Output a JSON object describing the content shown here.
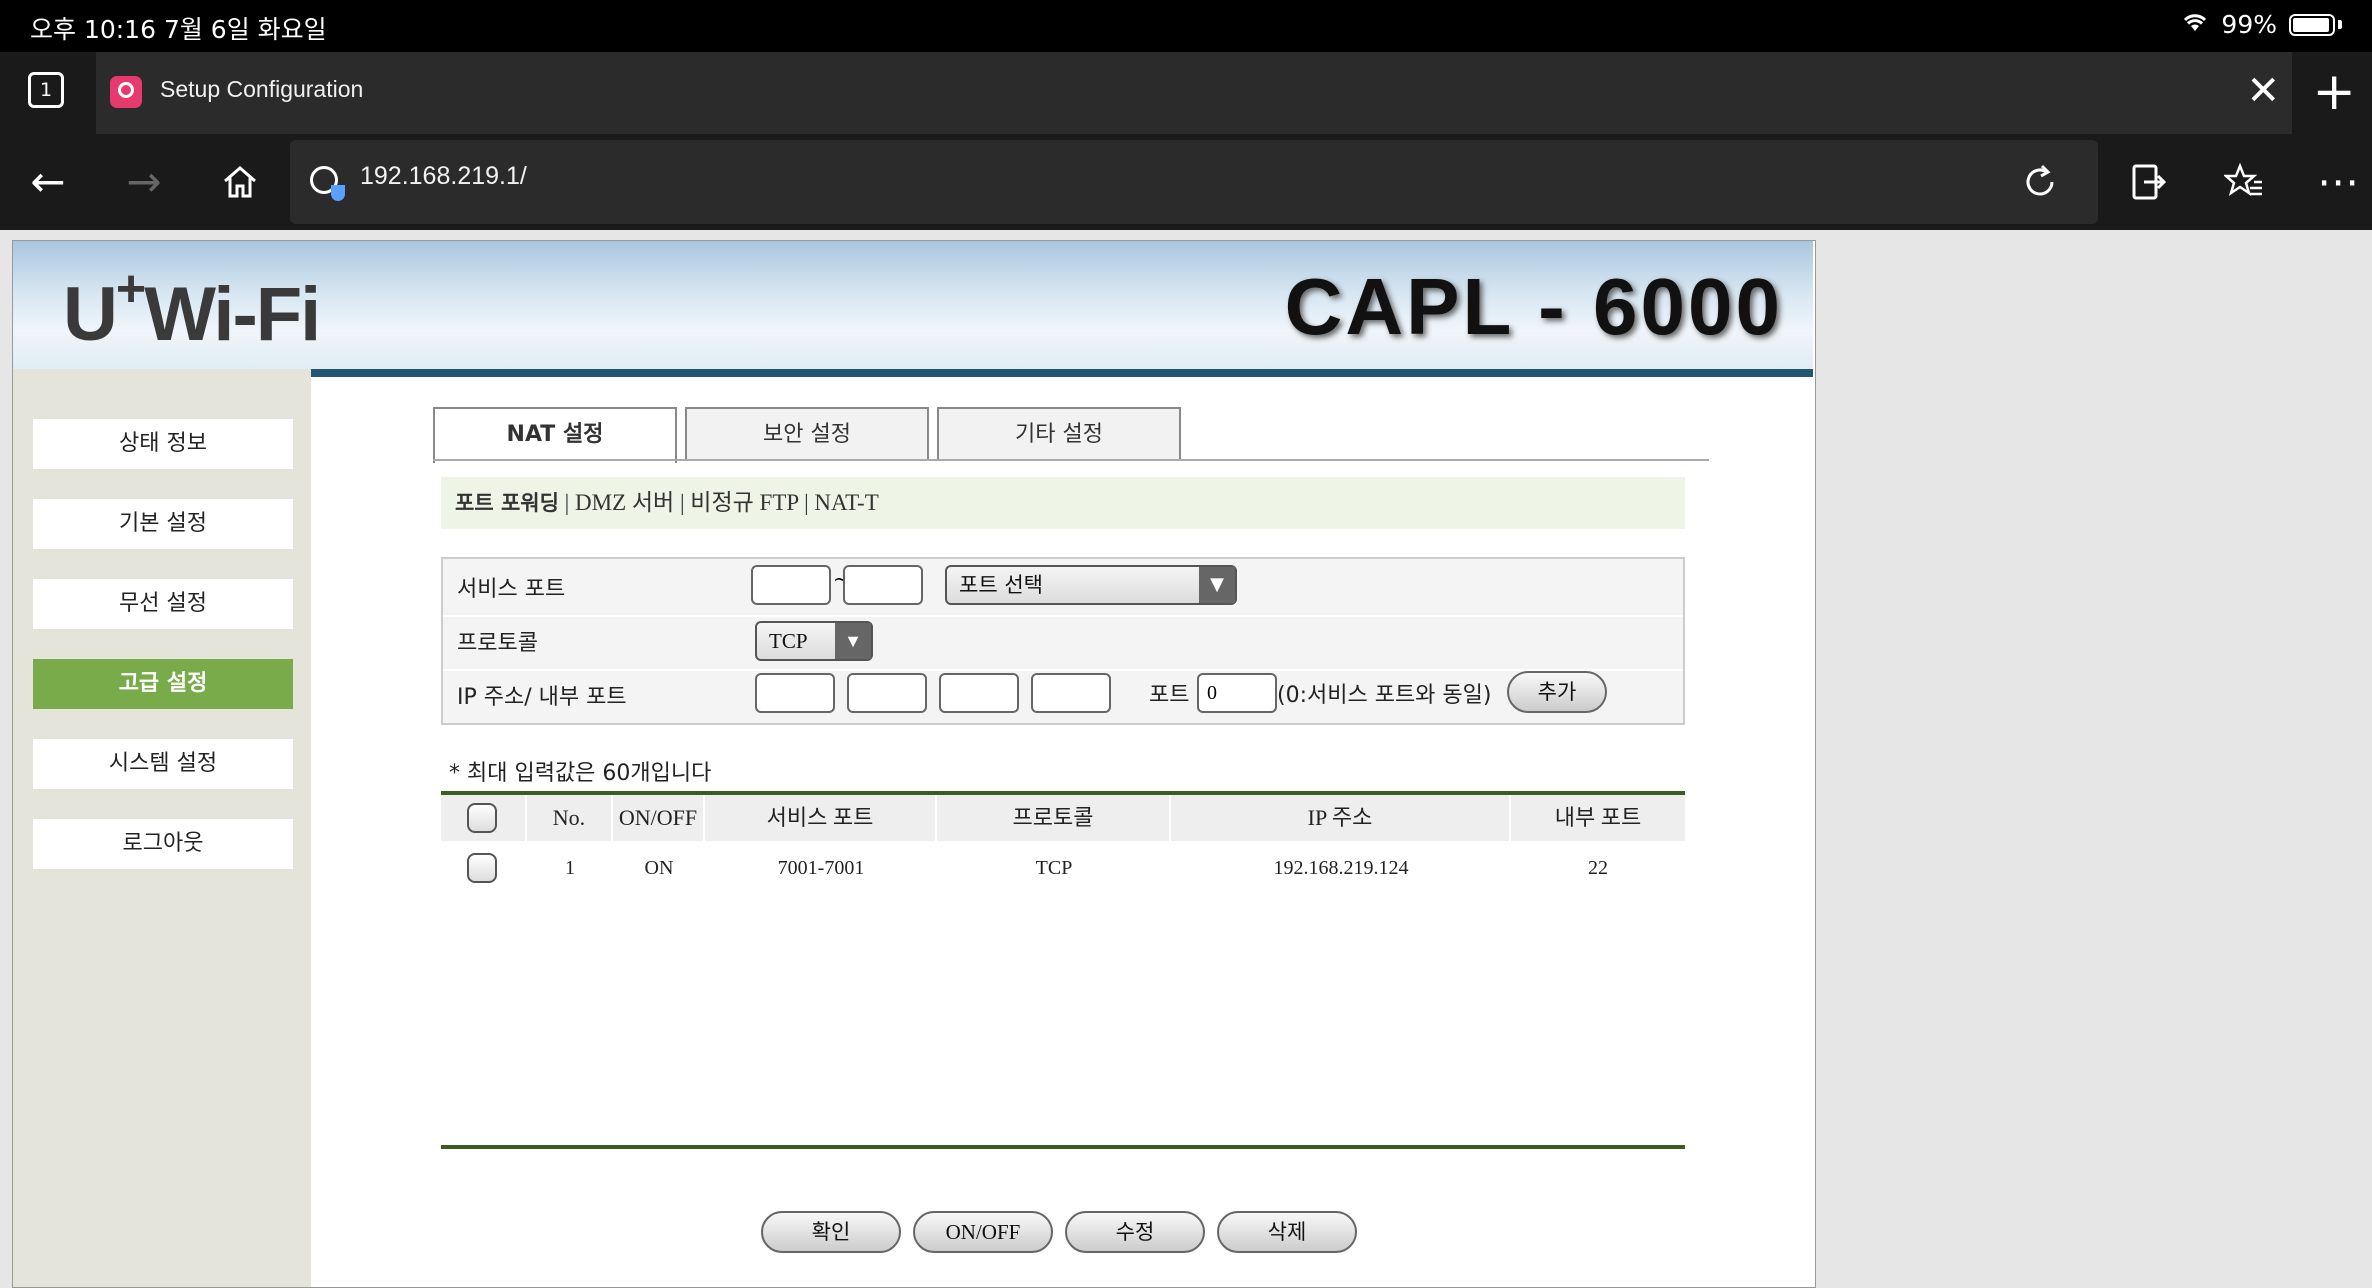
{
  "status_bar": {
    "time": "오후 10:16   7월 6일 화요일",
    "battery": "99%"
  },
  "browser": {
    "tab_count": "1",
    "tab_title": "Setup Configuration",
    "url": "192.168.219.1/"
  },
  "banner": {
    "logo": "U",
    "logo_sup": "+",
    "logo_rest": "Wi-Fi",
    "model": "CAPL - 6000"
  },
  "sidebar": {
    "items": [
      {
        "label": "상태 정보"
      },
      {
        "label": "기본 설정"
      },
      {
        "label": "무선 설정"
      },
      {
        "label": "고급 설정"
      },
      {
        "label": "시스템 설정"
      },
      {
        "label": "로그아웃"
      }
    ]
  },
  "tabs": [
    {
      "label": "NAT 설정"
    },
    {
      "label": "보안 설정"
    },
    {
      "label": "기타 설정"
    }
  ],
  "subnav": {
    "active": "포트 포워딩",
    "others": " | DMZ 서버 | 비정규 FTP | NAT-T"
  },
  "form": {
    "service_port_label": "서비스 포트",
    "port_range_sep": "~",
    "port_select": "포트 선택",
    "protocol_label": "프로토콜",
    "protocol_value": "TCP",
    "ip_label": "IP 주소/ 내부 포트",
    "port_label": "포트",
    "port_value": "0",
    "port_hint": "(0:서비스 포트와 동일)",
    "add_button": "추가"
  },
  "note": "* 최대 입력값은 60개입니다",
  "table": {
    "headers": [
      "No.",
      "ON/OFF",
      "서비스 포트",
      "프로토콜",
      "IP 주소",
      "내부 포트"
    ],
    "rows": [
      {
        "no": "1",
        "onoff": "ON",
        "service_port": "7001-7001",
        "protocol": "TCP",
        "ip": "192.168.219.124",
        "internal_port": "22"
      }
    ]
  },
  "buttons": {
    "confirm": "확인",
    "onoff": "ON/OFF",
    "edit": "수정",
    "delete": "삭제"
  }
}
